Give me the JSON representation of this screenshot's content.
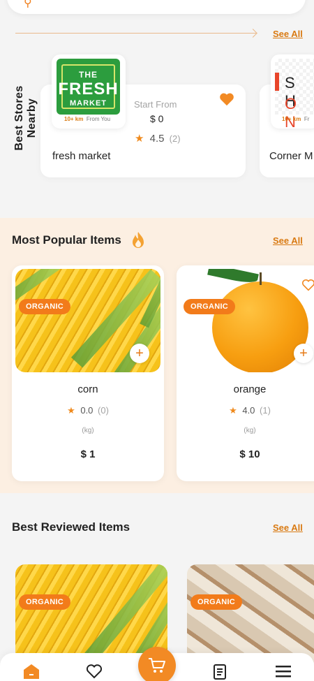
{
  "top": {
    "see_all_label": "See All"
  },
  "stores": {
    "section_title": "Best Stores Nearby",
    "items": [
      {
        "name": "fresh market",
        "logo_lines": [
          "THE",
          "FRESH",
          "MARKET"
        ],
        "distance": "10+ km",
        "distance_suffix": "From You",
        "start_from_label": "Start From",
        "start_from_value": "$ 0",
        "rating": "4.5",
        "reviews": "(2)"
      },
      {
        "name": "Corner M",
        "logo_lines": [
          "S H",
          "O N"
        ],
        "distance": "10+ km",
        "distance_suffix": "Fr"
      }
    ]
  },
  "popular": {
    "section_title": "Most Popular Items",
    "see_all_label": "See All",
    "items": [
      {
        "badge": "ORGANIC",
        "name": "corn",
        "rating": "0.0",
        "reviews": "(0)",
        "unit": "(kg)",
        "price": "$ 1"
      },
      {
        "badge": "ORGANIC",
        "name": "orange",
        "rating": "4.0",
        "reviews": "(1)",
        "unit": "(kg)",
        "price": "$ 10"
      }
    ]
  },
  "reviewed": {
    "section_title": "Best Reviewed Items",
    "see_all_label": "See All",
    "items": [
      {
        "badge": "ORGANIC"
      },
      {
        "badge": "ORGANIC"
      }
    ]
  },
  "icons": {
    "nav": [
      "home-icon",
      "heart-icon",
      "cart-icon",
      "orders-icon",
      "menu-icon"
    ]
  },
  "colors": {
    "accent": "#f28a24",
    "green_logo": "#2c9d3e"
  }
}
